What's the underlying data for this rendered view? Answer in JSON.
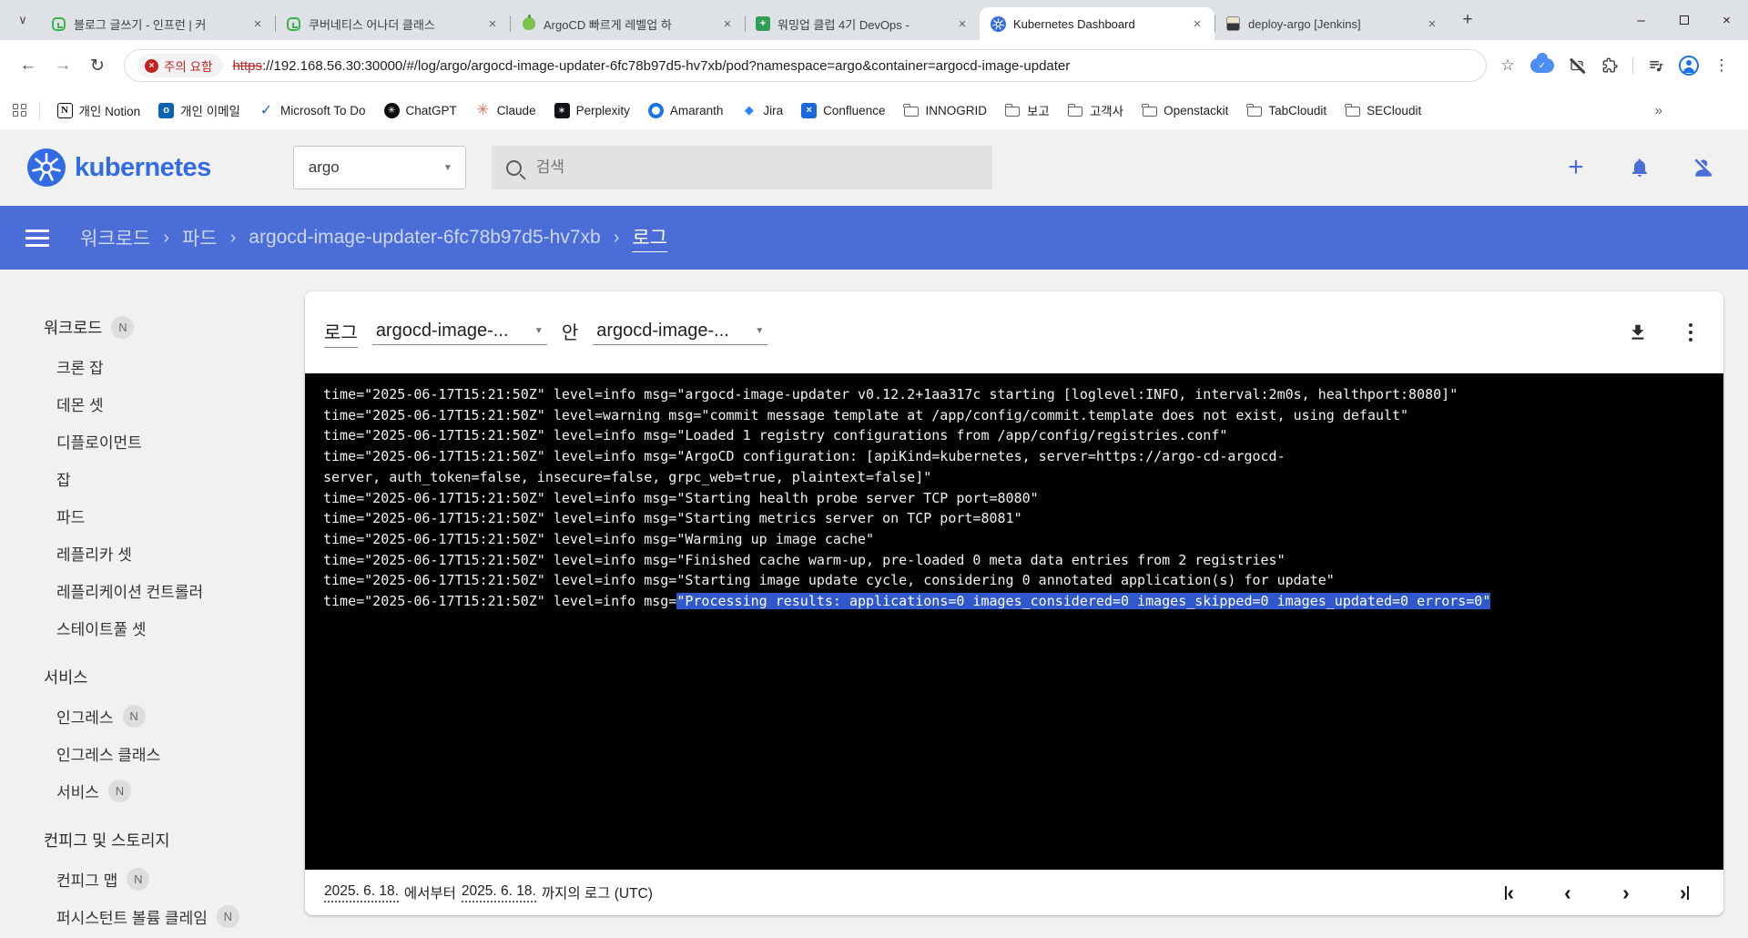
{
  "colors": {
    "accent_blue": "#4a6dd8",
    "logo_blue": "#326ce5",
    "selection_blue": "#2f58cd",
    "warning_red": "#c5221f"
  },
  "browser": {
    "tabs": [
      {
        "title": "블로그 글쓰기 - 인프런 | 커"
      },
      {
        "title": "쿠버네티스 어나더 클래스"
      },
      {
        "title": "ArgoCD 빠르게 레벨업 하"
      },
      {
        "title": "워밍업 클럽 4기 DevOps -"
      },
      {
        "title": "Kubernetes Dashboard"
      },
      {
        "title": "deploy-argo [Jenkins]"
      }
    ],
    "omnibox": {
      "warning_text": "주의 요함",
      "url_scheme": "https",
      "url_rest": "://192.168.56.30:30000/#/log/argo/argocd-image-updater-6fc78b97d5-hv7xb/pod?namespace=argo&container=argocd-image-updater"
    },
    "bookmarks": [
      {
        "label": "개인 Notion"
      },
      {
        "label": "개인 이메일"
      },
      {
        "label": "Microsoft To Do"
      },
      {
        "label": "ChatGPT"
      },
      {
        "label": "Claude"
      },
      {
        "label": "Perplexity"
      },
      {
        "label": "Amaranth"
      },
      {
        "label": "Jira"
      },
      {
        "label": "Confluence"
      },
      {
        "label": "INNOGRID"
      },
      {
        "label": "보고"
      },
      {
        "label": "고객사"
      },
      {
        "label": "Openstackit"
      },
      {
        "label": "TabCloudit"
      },
      {
        "label": "SECloudit"
      }
    ],
    "bookmarks_overflow": "»"
  },
  "header": {
    "logo_text": "kubernetes",
    "namespace": "argo",
    "search_placeholder": "검색"
  },
  "breadcrumb": {
    "item1": "워크로드",
    "item2": "파드",
    "item3": "argocd-image-updater-6fc78b97d5-hv7xb",
    "current": "로그",
    "sep": "›"
  },
  "sidebar": {
    "sections": [
      {
        "label": "워크로드",
        "badge": "N",
        "items": [
          {
            "label": "크론 잡"
          },
          {
            "label": "데몬 셋"
          },
          {
            "label": "디플로이먼트"
          },
          {
            "label": "잡"
          },
          {
            "label": "파드"
          },
          {
            "label": "레플리카 셋"
          },
          {
            "label": "레플리케이션 컨트롤러"
          },
          {
            "label": "스테이트풀 셋"
          }
        ]
      },
      {
        "label": "서비스",
        "items": [
          {
            "label": "인그레스",
            "badge": "N"
          },
          {
            "label": "인그레스 클래스"
          },
          {
            "label": "서비스",
            "badge": "N"
          }
        ]
      },
      {
        "label": "컨피그 및 스토리지",
        "items": [
          {
            "label": "컨피그 맵",
            "badge": "N"
          },
          {
            "label": "퍼시스턴트 볼륨 클레임",
            "badge": "N"
          }
        ]
      }
    ]
  },
  "log_panel": {
    "title_prefix": "로그",
    "container_select": "argocd-image-...",
    "infix": "안",
    "pod_select": "argocd-image-...",
    "lines": [
      "time=\"2025-06-17T15:21:50Z\" level=info msg=\"argocd-image-updater v0.12.2+1aa317c starting [loglevel:INFO, interval:2m0s, healthport:8080]\"",
      "time=\"2025-06-17T15:21:50Z\" level=warning msg=\"commit message template at /app/config/commit.template does not exist, using default\"",
      "time=\"2025-06-17T15:21:50Z\" level=info msg=\"Loaded 1 registry configurations from /app/config/registries.conf\"",
      "time=\"2025-06-17T15:21:50Z\" level=info msg=\"ArgoCD configuration: [apiKind=kubernetes, server=https://argo-cd-argocd-",
      "server, auth_token=false, insecure=false, grpc_web=true, plaintext=false]\"",
      "time=\"2025-06-17T15:21:50Z\" level=info msg=\"Starting health probe server TCP port=8080\"",
      "time=\"2025-06-17T15:21:50Z\" level=info msg=\"Starting metrics server on TCP port=8081\"",
      "time=\"2025-06-17T15:21:50Z\" level=info msg=\"Warming up image cache\"",
      "time=\"2025-06-17T15:21:50Z\" level=info msg=\"Finished cache warm-up, pre-loaded 0 meta data entries from 2 registries\"",
      "time=\"2025-06-17T15:21:50Z\" level=info msg=\"Starting image update cycle, considering 0 annotated application(s) for update\""
    ],
    "last_line": {
      "prefix": "time=\"2025-06-17T15:21:50Z\" level=info msg=",
      "highlight": "\"Processing results: applications=0 images_considered=0 images_skipped=0 images_updated=0 errors=0\""
    },
    "footer": {
      "from_date": "2025. 6. 18.",
      "between_text": "에서부터",
      "to_date": "2025. 6. 18.",
      "suffix_text": "까지의 로그 (UTC)"
    }
  }
}
